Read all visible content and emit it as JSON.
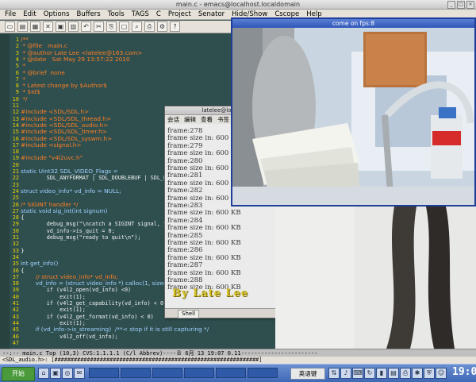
{
  "emacs": {
    "title": "main.c - emacs@localhost.localdomain",
    "menu": [
      "File",
      "Edit",
      "Options",
      "Buffers",
      "Tools",
      "TAGS",
      "C",
      "Project",
      "Senator",
      "Hide/Show",
      "Cscope",
      "Help"
    ],
    "toolbar_icons": [
      "new-file-icon",
      "open-file-icon",
      "open-dir-icon",
      "close-icon",
      "save-icon",
      "save-as-icon",
      "undo-icon",
      "cut-icon",
      "copy-icon",
      "paste-icon",
      "search-icon",
      "print-icon",
      "customize-icon",
      "help-icon"
    ],
    "line_numbers": [
      "1",
      "2",
      "3",
      "4",
      "5",
      "6",
      "7",
      "8",
      "9",
      "10",
      "11",
      "12",
      "13",
      "14",
      "15",
      "16",
      "17",
      "18",
      "19",
      "20",
      "21",
      "22",
      "23",
      "24",
      "25",
      "26",
      "27",
      "28",
      "29",
      "30",
      "31",
      "32",
      "33",
      "34",
      "35",
      "36",
      "37",
      "38",
      "39",
      "40",
      "41",
      "42",
      "43",
      "44",
      "45",
      "46",
      "47"
    ],
    "code_lines": [
      {
        "text": "/**",
        "cls": "cm"
      },
      {
        "text": " * @file   main.c",
        "cls": "cm"
      },
      {
        "text": " * @author Late Lee <latelee@163.com>",
        "cls": "cm"
      },
      {
        "text": " * @date   Sat May 29 13:57:22 2010",
        "cls": "cm"
      },
      {
        "text": " *",
        "cls": "cm"
      },
      {
        "text": " * @brief  none",
        "cls": "cm"
      },
      {
        "text": " *",
        "cls": "cm"
      },
      {
        "text": " * Latest change by $Author$",
        "cls": "cm"
      },
      {
        "text": " * $Id$",
        "cls": "cm"
      },
      {
        "text": " */",
        "cls": "cm"
      },
      {
        "text": "",
        "cls": ""
      },
      {
        "text": "#include <SDL/SDL.h>",
        "cls": "cm"
      },
      {
        "text": "#include <SDL/SDL_thread.h>",
        "cls": "cm"
      },
      {
        "text": "#include <SDL/SDL_audio.h>",
        "cls": "cm"
      },
      {
        "text": "#include <SDL/SDL_timer.h>",
        "cls": "cm"
      },
      {
        "text": "#include <SDL/SDL_syswm.h>",
        "cls": "cm"
      },
      {
        "text": "#include <signal.h>",
        "cls": "cm"
      },
      {
        "text": "",
        "cls": ""
      },
      {
        "text": "#include \"v4l2uvc.h\"",
        "cls": "cm"
      },
      {
        "text": "",
        "cls": ""
      },
      {
        "text": "static Uint32 SDL_VIDEO_Flags =",
        "cls": "kw"
      },
      {
        "text": "        SDL_ANYFORMAT | SDL_DOUBLEBUF | SDL_RESIZABLE;",
        "cls": "mono"
      },
      {
        "text": "",
        "cls": ""
      },
      {
        "text": "struct video_info* vd_info = NULL;",
        "cls": "kw"
      },
      {
        "text": "",
        "cls": ""
      },
      {
        "text": "/* SIGINT handler */",
        "cls": "cm"
      },
      {
        "text": "static void sig_int(int signum)",
        "cls": "kw"
      },
      {
        "text": "{",
        "cls": ""
      },
      {
        "text": "        debug_msg(\"\\ncatch a SIGINT signal, you may be",
        "cls": "mono"
      },
      {
        "text": "        vd_info->is_quit = 0;",
        "cls": "mono"
      },
      {
        "text": "        debug_msg(\"ready to quit\\n\");",
        "cls": "mono"
      },
      {
        "text": "",
        "cls": ""
      },
      {
        "text": "}",
        "cls": ""
      },
      {
        "text": "",
        "cls": ""
      },
      {
        "text": "int get_info()",
        "cls": "kw"
      },
      {
        "text": "{",
        "cls": ""
      },
      {
        "text": "        // struct video_info* vd_info;",
        "cls": "cm"
      },
      {
        "text": "        vd_info = (struct video_info *) calloc(1, sizeof",
        "cls": "kw"
      },
      {
        "text": "        if (v4l2_open(vd_info) <0)",
        "cls": "mono"
      },
      {
        "text": "            exit(1);",
        "cls": "mono"
      },
      {
        "text": "        if (v4l2_get_capability(vd_info) < 0)",
        "cls": "mono"
      },
      {
        "text": "            exit(1);",
        "cls": "mono"
      },
      {
        "text": "        if (v4l2_get_format(vd_info) < 0)",
        "cls": "mono"
      },
      {
        "text": "            exit(1);",
        "cls": "mono"
      },
      {
        "text": "        if (vd_info->is_streaming)  /**< stop if it is still capturing */",
        "cls": "kw"
      },
      {
        "text": "            v4l2_off(vd_info);",
        "cls": "mono"
      },
      {
        "text": "",
        "cls": ""
      }
    ],
    "modeline": "--:--  main.c          Top (10,3)     CVS:1.1.1.1    (C/l Abbrev)----Ｂ  6月 13 19:07 0.11-----------------------",
    "minibuffer": "<SDL_audio.h>: [###############################################################]"
  },
  "terminal": {
    "title": "latelee@local",
    "menu": [
      "会话",
      "编辑",
      "查看",
      "书签"
    ],
    "lines": [
      "frame:278",
      "frame size in: 600 KB",
      "frame:279",
      "frame size in: 600 KB",
      "frame:280",
      "frame size in: 600 KB",
      "frame:281",
      "frame size in: 600 KB",
      "frame:282",
      "frame size in: 600 KB",
      "frame:283",
      "frame size in: 600 KB",
      "frame:284",
      "frame size in: 600 KB",
      "frame:285",
      "frame size in: 600 KB",
      "frame:286",
      "frame size in: 600 KB",
      "frame:287",
      "frame size in: 600 KB",
      "frame:288",
      "frame size in: 600 KB"
    ],
    "tab_label": "Shell"
  },
  "camera": {
    "title": "come on fps:8",
    "watermark": "By Late Lee"
  },
  "taskbar": {
    "start_label": "开始",
    "quick_icons": [
      "home-icon",
      "terminal-icon",
      "browser-icon",
      "mail-icon"
    ],
    "tasks": [
      "",
      "",
      "",
      "",
      "",
      ""
    ],
    "ime_label": "英语键",
    "clock": "19:07"
  }
}
